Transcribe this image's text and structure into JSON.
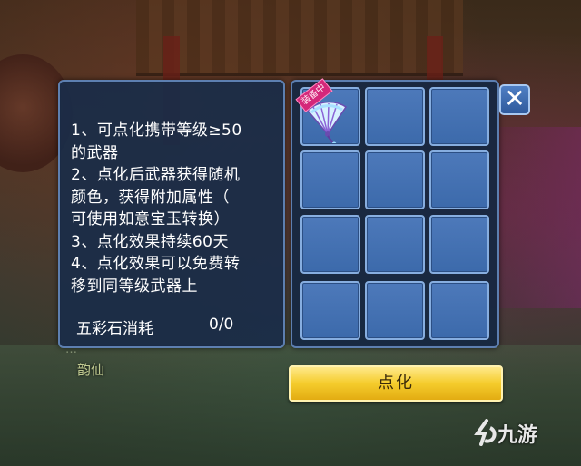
{
  "rules": [
    "1、可点化携带等级≥50",
    "的武器",
    "2、点化后武器获得随机",
    "颜色，获得附加属性（",
    "可使用如意宝玉转换）",
    "3、点化效果持续60天",
    "4、点化效果可以免费转",
    "移到同等级武器上"
  ],
  "cost": {
    "label": "五彩石消耗",
    "value": "0/0"
  },
  "slots": {
    "rows": 4,
    "cols": 3,
    "filled": [
      {
        "index": 0,
        "item": "fan-icon",
        "badge": "装备中"
      }
    ]
  },
  "close_label": "✕",
  "refine_button_label": "点化",
  "background": {
    "npc_name": "韵仙",
    "npc_title": "…"
  },
  "watermark": "九游",
  "colors": {
    "panel_bg": "#1a2c48",
    "panel_border": "#5d7fb0",
    "slot_bg": "#4d79ba",
    "button_gold": "#f5cc2c",
    "badge_pink": "#d4287a"
  }
}
